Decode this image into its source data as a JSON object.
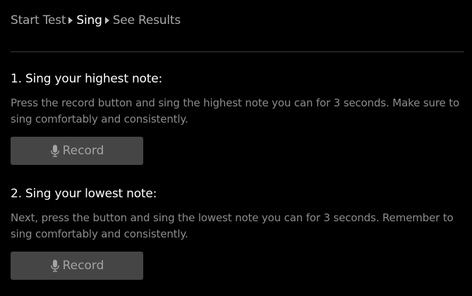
{
  "breadcrumb": {
    "items": [
      {
        "label": "Start Test",
        "active": false
      },
      {
        "label": "Sing",
        "active": true
      },
      {
        "label": "See Results",
        "active": false
      }
    ]
  },
  "steps": [
    {
      "heading": "1. Sing your highest note:",
      "description": "Press the record button and sing the highest note you can for 3 seconds. Make sure to sing comfortably and consistently.",
      "button": {
        "icon": "microphone-icon",
        "label": "Record"
      }
    },
    {
      "heading": "2. Sing your lowest note:",
      "description": "Next, press the button and sing the lowest note you can for 3 seconds. Remember to sing comfortably and consistently.",
      "button": {
        "icon": "microphone-icon",
        "label": "Record"
      }
    }
  ],
  "colors": {
    "background": "#000000",
    "active_crumb": "#ffffff",
    "inactive_crumb": "#a8a8a8",
    "description_text": "#8c8c8c",
    "button_background": "#454545",
    "button_text": "#a3a3a3"
  }
}
